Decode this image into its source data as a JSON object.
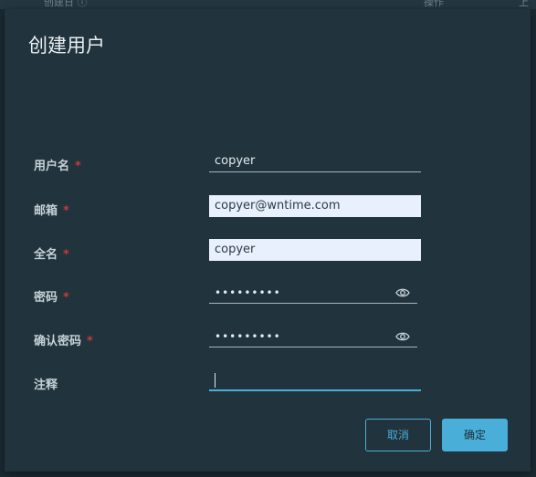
{
  "background": {
    "columns": [
      "创建日 ⓘ",
      "操作",
      "上"
    ]
  },
  "dialog": {
    "title": "创建用户",
    "required_mark": "*",
    "fields": [
      {
        "label": "用户名",
        "value": "copyer",
        "required": true
      },
      {
        "label": "邮箱",
        "value": "copyer@wntime.com",
        "required": true
      },
      {
        "label": "全名",
        "value": "copyer",
        "required": true
      },
      {
        "label": "密码",
        "value": "•••••••••",
        "required": true
      },
      {
        "label": "确认密码",
        "value": "•••••••••",
        "required": true
      },
      {
        "label": "注释",
        "value": "",
        "required": false
      }
    ],
    "buttons": {
      "cancel": "取消",
      "confirm": "确定"
    }
  },
  "colors": {
    "accent": "#49afd9",
    "required": "#c63a3a",
    "dialog_bg": "#21333c",
    "autofill_bg": "#e8f0fe"
  },
  "icons": {
    "password_toggle": "eye-icon"
  }
}
